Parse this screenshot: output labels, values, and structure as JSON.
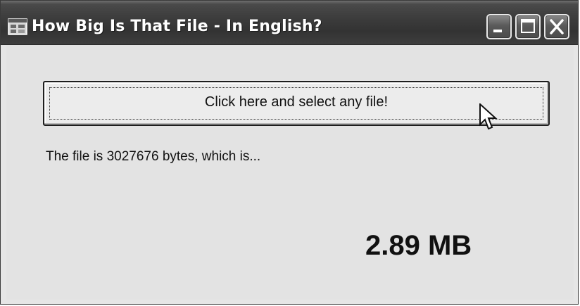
{
  "window": {
    "title": "How Big Is That File - In English?"
  },
  "icons": {
    "app": "app-window-icon",
    "minimize": "minimize-icon",
    "maximize": "maximize-icon",
    "close": "close-icon",
    "cursor": "mouse-pointer-icon"
  },
  "main": {
    "select_button_label": "Click here and select any file!",
    "info_text": "The file is 3027676 bytes, which is...",
    "size_result": "2.89 MB"
  }
}
